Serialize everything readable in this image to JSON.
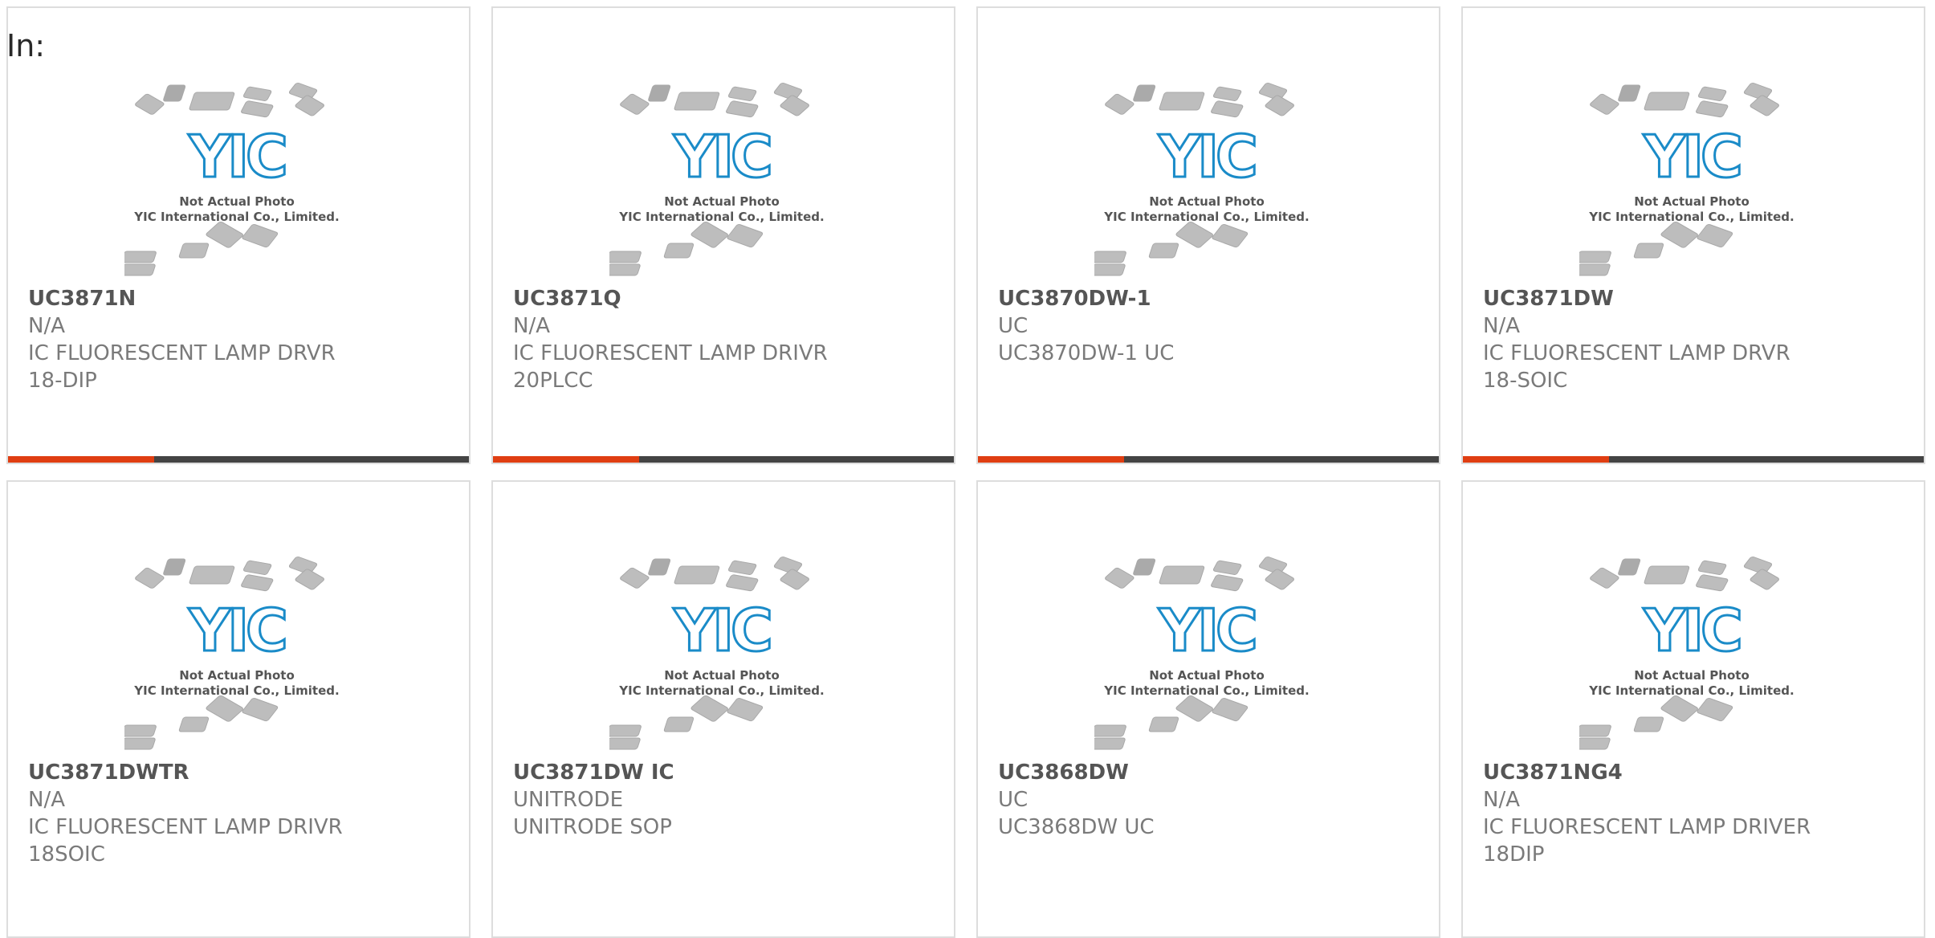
{
  "page": {
    "label": "In:"
  },
  "photo": {
    "caption_line1": "Not Actual Photo",
    "caption_line2": "YIC International Co., Limited.",
    "logo_text": "YIC",
    "logo_color": "#1a8bc8",
    "chip_color": "#bdbdbd"
  },
  "accent_color": "#e03e12",
  "bar_color": "#444444",
  "products": [
    {
      "part": "UC3871N",
      "maker": "N/A",
      "desc": "IC FLUORESCENT LAMP DRVR",
      "pkg": "18-DIP"
    },
    {
      "part": "UC3871Q",
      "maker": "N/A",
      "desc": "IC FLUORESCENT LAMP DRIVR",
      "pkg": "20PLCC"
    },
    {
      "part": "UC3870DW-1",
      "maker": "UC",
      "desc": "UC3870DW-1 UC",
      "pkg": ""
    },
    {
      "part": "UC3871DW",
      "maker": "N/A",
      "desc": "IC FLUORESCENT LAMP DRVR",
      "pkg": "18-SOIC"
    },
    {
      "part": "UC3871DWTR",
      "maker": "N/A",
      "desc": "IC FLUORESCENT LAMP DRIVR",
      "pkg": "18SOIC"
    },
    {
      "part": "UC3871DW IC",
      "maker": "UNITRODE",
      "desc": "UNITRODE SOP",
      "pkg": ""
    },
    {
      "part": "UC3868DW",
      "maker": "UC",
      "desc": "UC3868DW UC",
      "pkg": ""
    },
    {
      "part": "UC3871NG4",
      "maker": "N/A",
      "desc": "IC FLUORESCENT LAMP DRIVER",
      "pkg": "18DIP"
    }
  ]
}
